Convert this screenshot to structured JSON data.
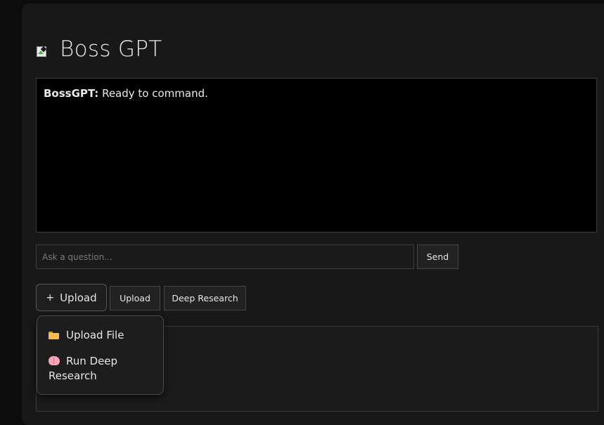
{
  "app": {
    "title": "Boss GPT",
    "logo_icon": "broken-image-icon"
  },
  "chat": {
    "messages": [
      {
        "sender": "BossGPT:",
        "text": " Ready to command."
      }
    ]
  },
  "input": {
    "placeholder": "Ask a question...",
    "value": ""
  },
  "buttons": {
    "send": "Send",
    "upload_toggle_icon": "+",
    "upload_toggle_label": "Upload",
    "upload": "Upload",
    "deep_research": "Deep Research"
  },
  "dropdown": {
    "items": [
      {
        "icon": "folder-icon",
        "label": "Upload File"
      },
      {
        "icon": "brain-icon",
        "label": "Run Deep Research"
      }
    ]
  },
  "colors": {
    "background": "#0c0c0c",
    "panel": "#181818",
    "chat_background": "#000000",
    "text": "#e6e6e6"
  }
}
